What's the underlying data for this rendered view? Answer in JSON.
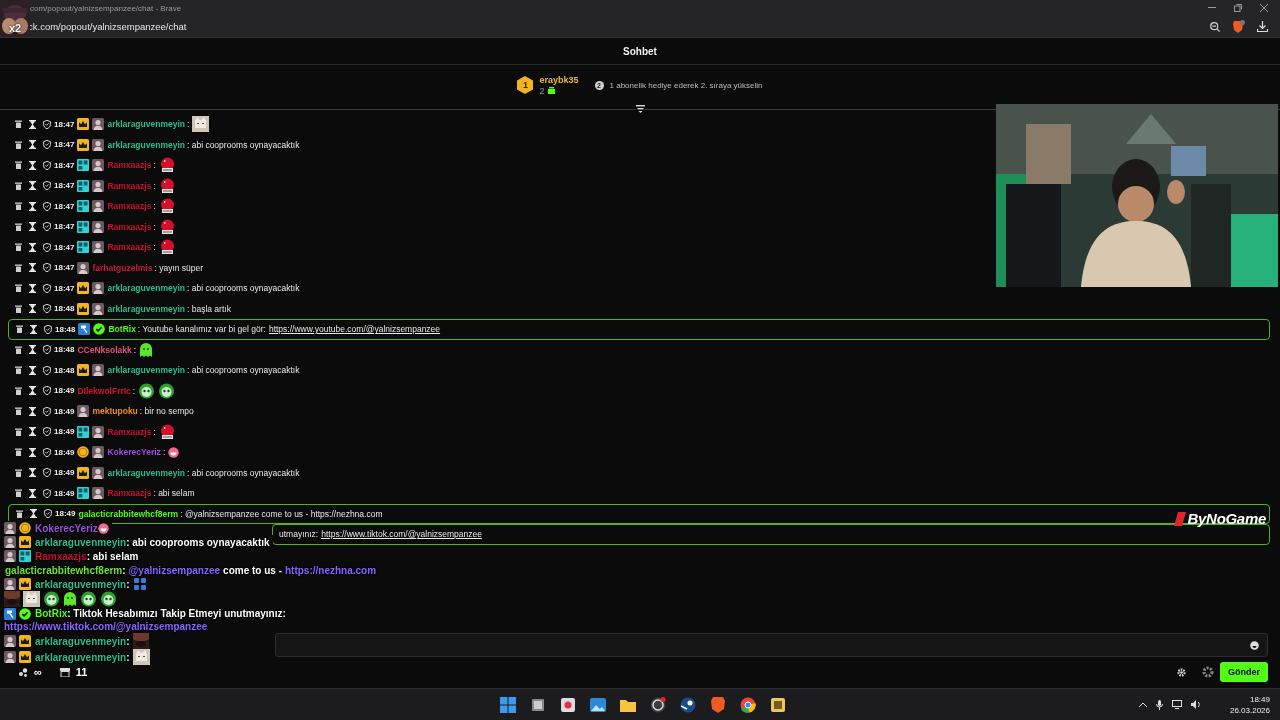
{
  "browser": {
    "sticker": "x2",
    "title": "com/popout/yalnizsempanzee/chat - Brave",
    "address": "ck.com/popout/yalnizsempanzee/chat"
  },
  "chat": {
    "title": "Sohbet",
    "leader": {
      "rank": "1",
      "name": "eraybk35",
      "count": "2",
      "next_rank": "2",
      "hint": "1 abonelik hediye ederek 2. sıraya yükselin"
    },
    "rows": [
      {
        "kind": "message",
        "time": "18:47",
        "badges": [
          {
            "kind": "crown"
          },
          {
            "kind": "avatar"
          }
        ],
        "user": "arklaraguvenmeyin",
        "color": "#2ebd8c",
        "highlighted": false,
        "parts": [
          {
            "kind": "text",
            "text": ":"
          },
          {
            "kind": "cat"
          }
        ]
      },
      {
        "kind": "message",
        "time": "18:47",
        "badges": [
          {
            "kind": "crown"
          },
          {
            "kind": "avatar"
          }
        ],
        "user": "arklaraguvenmeyin",
        "color": "#2ebd8c",
        "highlighted": false,
        "parts": [
          {
            "kind": "text",
            "text": ": abi cooprooms oynayacaktık"
          }
        ]
      },
      {
        "kind": "message",
        "time": "18:47",
        "badges": [
          {
            "kind": "og"
          },
          {
            "kind": "avatar"
          }
        ],
        "user": "Ramxaazjs",
        "color": "#c8102e",
        "highlighted": false,
        "parts": [
          {
            "kind": "text",
            "text": ":"
          },
          {
            "kind": "blob"
          }
        ]
      },
      {
        "kind": "message",
        "time": "18:47",
        "badges": [
          {
            "kind": "og"
          },
          {
            "kind": "avatar"
          }
        ],
        "user": "Ramxaazjs",
        "color": "#c8102e",
        "highlighted": false,
        "parts": [
          {
            "kind": "text",
            "text": ":"
          },
          {
            "kind": "blob"
          }
        ]
      },
      {
        "kind": "message",
        "time": "18:47",
        "badges": [
          {
            "kind": "og"
          },
          {
            "kind": "avatar"
          }
        ],
        "user": "Ramxaazjs",
        "color": "#c8102e",
        "highlighted": false,
        "parts": [
          {
            "kind": "text",
            "text": ":"
          },
          {
            "kind": "blob"
          }
        ]
      },
      {
        "kind": "message",
        "time": "18:47",
        "badges": [
          {
            "kind": "og"
          },
          {
            "kind": "avatar"
          }
        ],
        "user": "Ramxaazjs",
        "color": "#c8102e",
        "highlighted": false,
        "parts": [
          {
            "kind": "text",
            "text": ":"
          },
          {
            "kind": "blob"
          }
        ]
      },
      {
        "kind": "message",
        "time": "18:47",
        "badges": [
          {
            "kind": "og"
          },
          {
            "kind": "avatar"
          }
        ],
        "user": "Ramxaazjs",
        "color": "#c8102e",
        "highlighted": false,
        "parts": [
          {
            "kind": "text",
            "text": ":"
          },
          {
            "kind": "blob"
          }
        ]
      },
      {
        "kind": "message",
        "time": "18:47",
        "badges": [
          {
            "kind": "avatar"
          }
        ],
        "user": "farhatguzelmis",
        "color": "#c61a3c",
        "highlighted": false,
        "parts": [
          {
            "kind": "text",
            "text": ": yayın süper"
          }
        ]
      },
      {
        "kind": "message",
        "time": "18:47",
        "badges": [
          {
            "kind": "crown"
          },
          {
            "kind": "avatar"
          }
        ],
        "user": "arklaraguvenmeyin",
        "color": "#2ebd8c",
        "highlighted": false,
        "parts": [
          {
            "kind": "text",
            "text": ": abi cooprooms oynayacaktık"
          }
        ]
      },
      {
        "kind": "message",
        "time": "18:48",
        "badges": [
          {
            "kind": "crown"
          },
          {
            "kind": "avatar"
          }
        ],
        "user": "arklaraguvenmeyin",
        "color": "#2ebd8c",
        "highlighted": false,
        "parts": [
          {
            "kind": "text",
            "text": ": başla artık"
          }
        ]
      },
      {
        "kind": "message",
        "time": "18:48",
        "badges": [
          {
            "kind": "bot"
          },
          {
            "kind": "verified"
          }
        ],
        "user": "BotRix",
        "color": "#53fc18",
        "highlighted": true,
        "parts": [
          {
            "kind": "text",
            "text": ": Youtube kanalımız var bi gel gör:"
          },
          {
            "kind": "link",
            "text": "https://www.youtube.com/@yalnizsempanzee"
          }
        ]
      },
      {
        "kind": "message",
        "time": "18:48",
        "user": "CCeNksolakk",
        "color": "#e0507a",
        "highlighted": false,
        "parts": [
          {
            "kind": "text",
            "text": ":"
          },
          {
            "kind": "ghost"
          }
        ]
      },
      {
        "kind": "message",
        "time": "18:48",
        "badges": [
          {
            "kind": "crown"
          },
          {
            "kind": "avatar"
          }
        ],
        "user": "arklaraguvenmeyin",
        "color": "#2ebd8c",
        "highlighted": false,
        "parts": [
          {
            "kind": "text",
            "text": ": abi cooprooms oynayacaktık"
          }
        ]
      },
      {
        "kind": "message",
        "time": "18:49",
        "user": "DIlekwolFrrIc",
        "color": "#d01436",
        "highlighted": false,
        "parts": [
          {
            "kind": "text",
            "text": ":"
          },
          {
            "kind": "face"
          },
          {
            "kind": "face"
          }
        ]
      },
      {
        "kind": "message",
        "time": "18:49",
        "badges": [
          {
            "kind": "avatar"
          }
        ],
        "user": "mektupoku",
        "color": "#e8902a",
        "highlighted": false,
        "parts": [
          {
            "kind": "text",
            "text": ": bir no sempo"
          }
        ]
      },
      {
        "kind": "message",
        "time": "18:49",
        "badges": [
          {
            "kind": "og"
          },
          {
            "kind": "avatar"
          }
        ],
        "user": "Ramxaazjs",
        "color": "#c8102e",
        "highlighted": false,
        "parts": [
          {
            "kind": "text",
            "text": ":"
          },
          {
            "kind": "blob"
          }
        ]
      },
      {
        "kind": "message",
        "time": "18:49",
        "badges": [
          {
            "kind": "coin"
          },
          {
            "kind": "avatar"
          }
        ],
        "user": "KokerecYeriz",
        "color": "#9a50e0",
        "highlighted": false,
        "parts": [
          {
            "kind": "text",
            "text": ":"
          },
          {
            "kind": "grin"
          }
        ]
      },
      {
        "kind": "message",
        "time": "18:49",
        "badges": [
          {
            "kind": "crown"
          },
          {
            "kind": "avatar"
          }
        ],
        "user": "arklaraguvenmeyin",
        "color": "#2ebd8c",
        "highlighted": false,
        "parts": [
          {
            "kind": "text",
            "text": ": abi cooprooms oynayacaktık"
          }
        ]
      },
      {
        "kind": "message",
        "time": "18:49",
        "badges": [
          {
            "kind": "og"
          },
          {
            "kind": "avatar"
          }
        ],
        "user": "Ramxaazjs",
        "color": "#c8102e",
        "highlighted": false,
        "parts": [
          {
            "kind": "text",
            "text": ": abi selam"
          }
        ]
      },
      {
        "kind": "message",
        "time": "18:49",
        "user": "galacticrabbitewhcf8erm",
        "color": "#53fc18",
        "highlighted": true,
        "parts": [
          {
            "kind": "text",
            "text": ": @yalnizsempanzee come to us - https://nezhna.com"
          }
        ]
      },
      {
        "kind": "covered",
        "highlighted": true,
        "parts": [
          {
            "kind": "text",
            "text": "utmayınız:"
          },
          {
            "kind": "link",
            "text": "https://www.tiktok.com/@yalnizsempanzee"
          }
        ]
      }
    ],
    "footer": {
      "infinity": "∞",
      "store_count": "11",
      "send": "Gönder"
    }
  },
  "overlay": {
    "logo": "ByNoGame",
    "lines": [
      {
        "badges": [
          {
            "kind": "avatar"
          },
          {
            "kind": "coin"
          }
        ],
        "user": "KokerecYeriz",
        "color": "#9a50e0",
        "parts": [
          {
            "kind": "grin"
          }
        ]
      },
      {
        "badges": [
          {
            "kind": "avatar"
          },
          {
            "kind": "crown"
          }
        ],
        "user": "arklaraguvenmeyin",
        "color": "#2ebd8c",
        "parts": [
          {
            "kind": "text",
            "text": " : abi cooprooms oynayacaktık"
          }
        ]
      },
      {
        "badges": [
          {
            "kind": "avatar"
          },
          {
            "kind": "og"
          }
        ],
        "user": "Ramxaazjs",
        "color": "#c8102e",
        "parts": [
          {
            "kind": "text",
            "text": " : abi selam"
          }
        ]
      },
      {
        "user": "galacticrabbitewhcf8erm",
        "color": "#6fe03a",
        "parts": [
          {
            "kind": "text",
            "text": " :"
          },
          {
            "kind": "mention",
            "text": "@yalnizsempanzee"
          },
          {
            "kind": "text",
            "text": "come to us -"
          },
          {
            "kind": "link",
            "text": "https://nezhna.com"
          }
        ]
      },
      {
        "badges": [
          {
            "kind": "avatar"
          },
          {
            "kind": "crown"
          }
        ],
        "user": "arklaraguvenmeyin",
        "color": "#2ebd8c",
        "parts": [
          {
            "kind": "text",
            "text": " :"
          },
          {
            "kind": "letters"
          },
          {
            "kind": "break"
          },
          {
            "kind": "dark"
          },
          {
            "kind": "cat"
          },
          {
            "kind": "face"
          },
          {
            "kind": "ghost"
          },
          {
            "kind": "face"
          },
          {
            "kind": "face"
          }
        ]
      },
      {
        "badges": [
          {
            "kind": "bot"
          },
          {
            "kind": "verified"
          }
        ],
        "user": "BotRix",
        "color": "#53fc18",
        "parts": [
          {
            "kind": "text",
            "text": " : Tiktok Hesabımızı Takip Etmeyi unutmayınız:"
          },
          {
            "kind": "break"
          },
          {
            "kind": "link",
            "text": "https://www.tiktok.com/@yalnizsempanzee"
          }
        ]
      },
      {
        "badges": [
          {
            "kind": "avatar"
          },
          {
            "kind": "crown"
          }
        ],
        "user": "arklaraguvenmeyin",
        "color": "#2ebd8c",
        "parts": [
          {
            "kind": "text",
            "text": " :"
          },
          {
            "kind": "dark"
          }
        ]
      },
      {
        "badges": [
          {
            "kind": "avatar"
          },
          {
            "kind": "crown"
          }
        ],
        "user": "arklaraguvenmeyin",
        "color": "#2ebd8c",
        "parts": [
          {
            "kind": "text",
            "text": " :"
          },
          {
            "kind": "cat"
          }
        ]
      }
    ]
  },
  "taskbar": {
    "apps": [
      {
        "kind": "windows"
      },
      {
        "kind": "taskview"
      },
      {
        "kind": "snip"
      },
      {
        "kind": "photos"
      },
      {
        "kind": "folder"
      },
      {
        "kind": "obs"
      },
      {
        "kind": "steam"
      },
      {
        "kind": "brave"
      },
      {
        "kind": "chrome"
      },
      {
        "kind": "app"
      }
    ],
    "time": "18:49",
    "date": "26.03.2026"
  }
}
